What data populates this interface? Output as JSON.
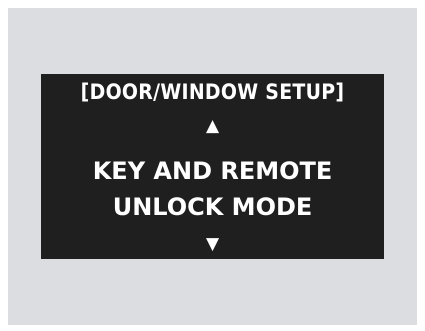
{
  "display": {
    "title": "[DOOR/WINDOW SETUP]",
    "up_arrow": "▲",
    "line1": "KEY AND REMOTE",
    "line2": "UNLOCK MODE",
    "down_arrow": "▼"
  },
  "colors": {
    "background": "#dcdde0",
    "screen": "#1f1f1f",
    "text": "#ffffff"
  },
  "icons": {
    "up": "up-arrow-icon",
    "down": "down-arrow-icon"
  }
}
